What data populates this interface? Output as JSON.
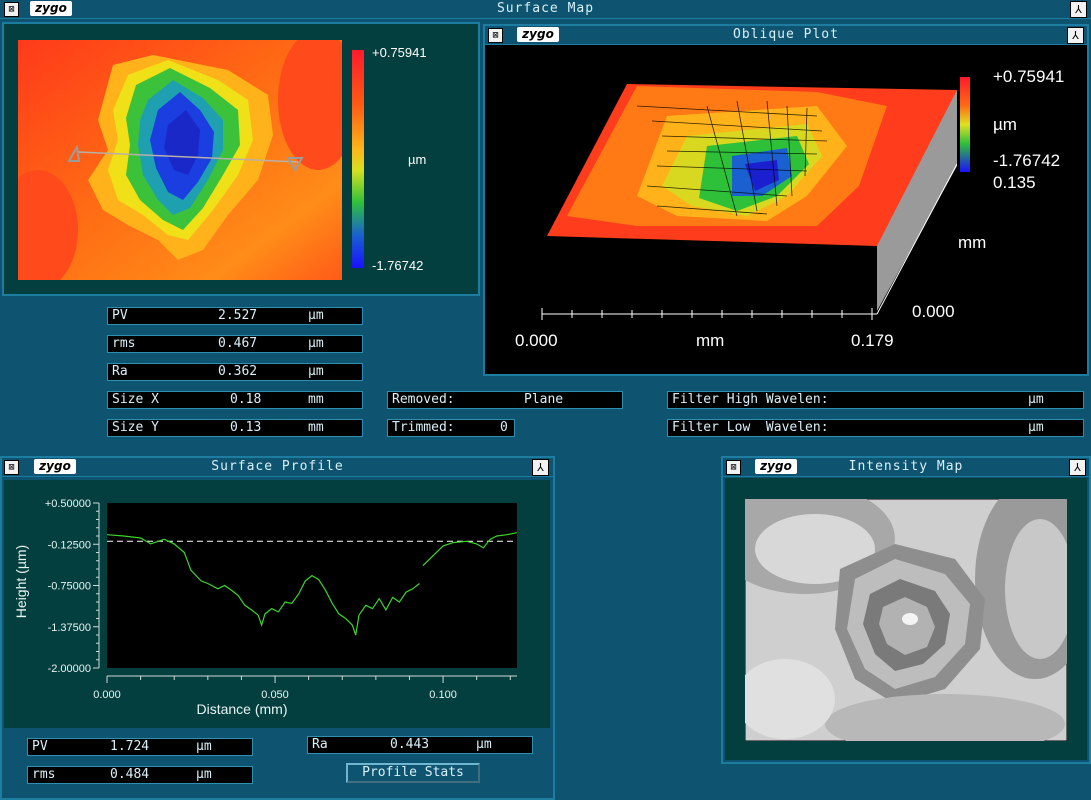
{
  "app": {
    "title": "Surface Map",
    "logo": "zygo"
  },
  "surface_map": {
    "colorbar_max": "+0.75941",
    "colorbar_unit": "µm",
    "colorbar_min": "-1.76742"
  },
  "oblique_plot": {
    "title": "Oblique Plot",
    "logo": "zygo",
    "z_max": "+0.75941",
    "z_unit": "µm",
    "z_min": "-1.76742",
    "y_max": "0.135",
    "y_unit": "mm",
    "y_min": "0.000",
    "x_min": "0.000",
    "x_unit": "mm",
    "x_max": "0.179"
  },
  "stats": {
    "pv": {
      "label": "PV",
      "value": "2.527",
      "unit": "µm"
    },
    "rms": {
      "label": "rms",
      "value": "0.467",
      "unit": "µm"
    },
    "ra": {
      "label": "Ra",
      "value": "0.362",
      "unit": "µm"
    },
    "size_x": {
      "label": "Size X",
      "value": "0.18",
      "unit": "mm"
    },
    "size_y": {
      "label": "Size Y",
      "value": "0.13",
      "unit": "mm"
    },
    "removed": {
      "label": "Removed:",
      "value": "Plane"
    },
    "trimmed": {
      "label": "Trimmed:",
      "value": "0"
    },
    "filter_high": {
      "label": "Filter High Wavelen:",
      "unit": "µm"
    },
    "filter_low": {
      "label": "Filter Low  Wavelen:",
      "unit": "µm"
    }
  },
  "profile": {
    "title": "Surface Profile",
    "logo": "zygo",
    "pv": {
      "label": "PV",
      "value": "1.724",
      "unit": "µm"
    },
    "rms": {
      "label": "rms",
      "value": "0.484",
      "unit": "µm"
    },
    "ra": {
      "label": "Ra",
      "value": "0.443",
      "unit": "µm"
    },
    "stats_button": "Profile Stats"
  },
  "intensity": {
    "title": "Intensity Map",
    "logo": "zygo"
  },
  "chart_data": {
    "type": "line",
    "xlabel": "Distance (mm)",
    "ylabel": "Height (µm)",
    "xlim": [
      0,
      0.122
    ],
    "ylim": [
      -2.0,
      0.5
    ],
    "x_ticks": [
      "0.000",
      "0.050",
      "0.100"
    ],
    "x_tick_values": [
      0,
      0.05,
      0.1
    ],
    "y_ticks": [
      "+0.50000",
      "-0.12500",
      "-0.75000",
      "-1.37500",
      "-2.00000"
    ],
    "y_tick_values": [
      0.5,
      -0.125,
      -0.75,
      -1.375,
      -2.0
    ],
    "reference_line": -0.08,
    "series": [
      {
        "color": "#3dd62b",
        "x": [
          0.0,
          0.005,
          0.01,
          0.013,
          0.017,
          0.02,
          0.023,
          0.025,
          0.028,
          0.03,
          0.033,
          0.035,
          0.037,
          0.039,
          0.041,
          0.043,
          0.045,
          0.046,
          0.047,
          0.049,
          0.051,
          0.053,
          0.055,
          0.057,
          0.059,
          0.061,
          0.063,
          0.065,
          0.067,
          0.069,
          0.071,
          0.073,
          0.074,
          0.075,
          0.077,
          0.079,
          0.081,
          0.083,
          0.085,
          0.087,
          0.089,
          0.091,
          0.093
        ],
        "y": [
          0.02,
          0.0,
          -0.03,
          -0.12,
          -0.05,
          -0.12,
          -0.25,
          -0.52,
          -0.68,
          -0.72,
          -0.8,
          -0.75,
          -0.82,
          -0.9,
          -1.05,
          -1.12,
          -1.2,
          -1.35,
          -1.18,
          -1.1,
          -1.15,
          -1.0,
          -1.02,
          -0.88,
          -0.68,
          -0.6,
          -0.66,
          -0.82,
          -1.02,
          -1.18,
          -1.25,
          -1.35,
          -1.5,
          -1.2,
          -1.05,
          -1.1,
          -0.95,
          -1.12,
          -0.93,
          -1.0,
          -0.85,
          -0.8,
          -0.72
        ]
      },
      {
        "color": "#3dd62b",
        "x": [
          0.094,
          0.097,
          0.1,
          0.103,
          0.107,
          0.11,
          0.112,
          0.114,
          0.116,
          0.119,
          0.122
        ],
        "y": [
          -0.45,
          -0.3,
          -0.15,
          -0.1,
          -0.08,
          -0.12,
          -0.18,
          -0.05,
          0.0,
          0.02,
          0.05
        ]
      }
    ]
  }
}
